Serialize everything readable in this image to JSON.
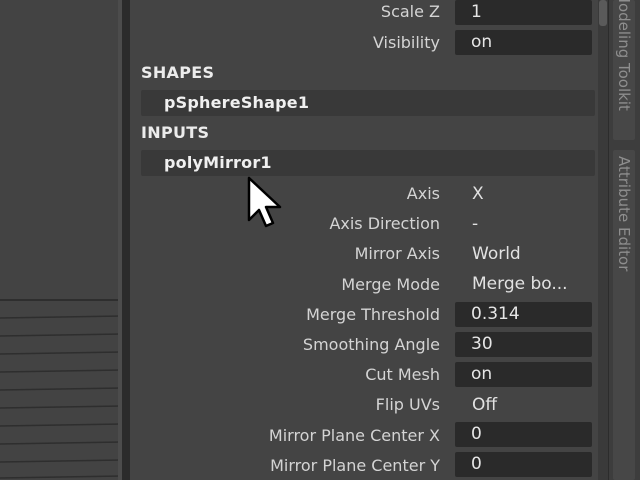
{
  "sidebar_tabs": [
    {
      "label": "Modeling Toolkit"
    },
    {
      "label": "Attribute Editor"
    }
  ],
  "transform_rows": [
    {
      "label": "Scale Z",
      "value": "1"
    },
    {
      "label": "Visibility",
      "value": "on"
    }
  ],
  "shapes": {
    "header": "SHAPES",
    "node": "pSphereShape1"
  },
  "inputs": {
    "header": "INPUTS",
    "node": "polyMirror1",
    "rows": [
      {
        "label": "Axis",
        "value": "X",
        "kind": "text"
      },
      {
        "label": "Axis Direction",
        "value": "-",
        "kind": "text"
      },
      {
        "label": "Mirror Axis",
        "value": "World",
        "kind": "text"
      },
      {
        "label": "Merge Mode",
        "value": "Merge bo...",
        "kind": "text"
      },
      {
        "label": "Merge Threshold",
        "value": "0.314",
        "kind": "field"
      },
      {
        "label": "Smoothing Angle",
        "value": "30",
        "kind": "field"
      },
      {
        "label": "Cut Mesh",
        "value": "on",
        "kind": "field"
      },
      {
        "label": "Flip UVs",
        "value": "Off",
        "kind": "text"
      },
      {
        "label": "Mirror Plane Center X",
        "value": "0",
        "kind": "field"
      },
      {
        "label": "Mirror Plane Center Y",
        "value": "0",
        "kind": "field"
      }
    ]
  },
  "icons": {
    "cursor": "arrow-cursor-icon"
  },
  "colors": {
    "panel_bg": "#444444",
    "field_bg": "#2a2a2a",
    "node_bar_bg": "#393939",
    "text": "#d4d4d4"
  }
}
